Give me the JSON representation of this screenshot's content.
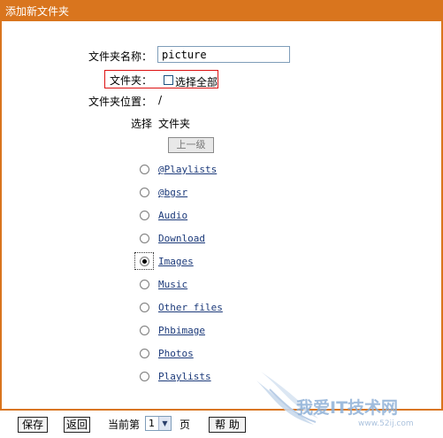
{
  "dialog": {
    "title": "添加新文件夹"
  },
  "form": {
    "folder_name_label": "文件夹名称：",
    "folder_name_value": "picture",
    "folder_label": "文件夹：",
    "select_all_label": "选择全部",
    "folder_location_label": "文件夹位置：",
    "folder_location_value": "/"
  },
  "table": {
    "col_select": "选择",
    "col_folder": "文件夹",
    "up_button": "上一级",
    "selected_index": 4,
    "folders": [
      "@Playlists",
      "@bgsr",
      "Audio",
      "Download",
      "Images",
      "Music",
      "Other files",
      "Phbimage",
      "Photos",
      "Playlists"
    ]
  },
  "footer": {
    "save": "保存",
    "back": "返回",
    "current_page_label": "当前第",
    "page_value": "1",
    "page_suffix": "页",
    "help": "帮 助"
  },
  "watermark": {
    "text": "我爱IT技术网",
    "url": "www.52ij.com"
  },
  "colors": {
    "frame": "#d9751e",
    "link": "#1c3a7a",
    "highlight": "#dd1111"
  }
}
